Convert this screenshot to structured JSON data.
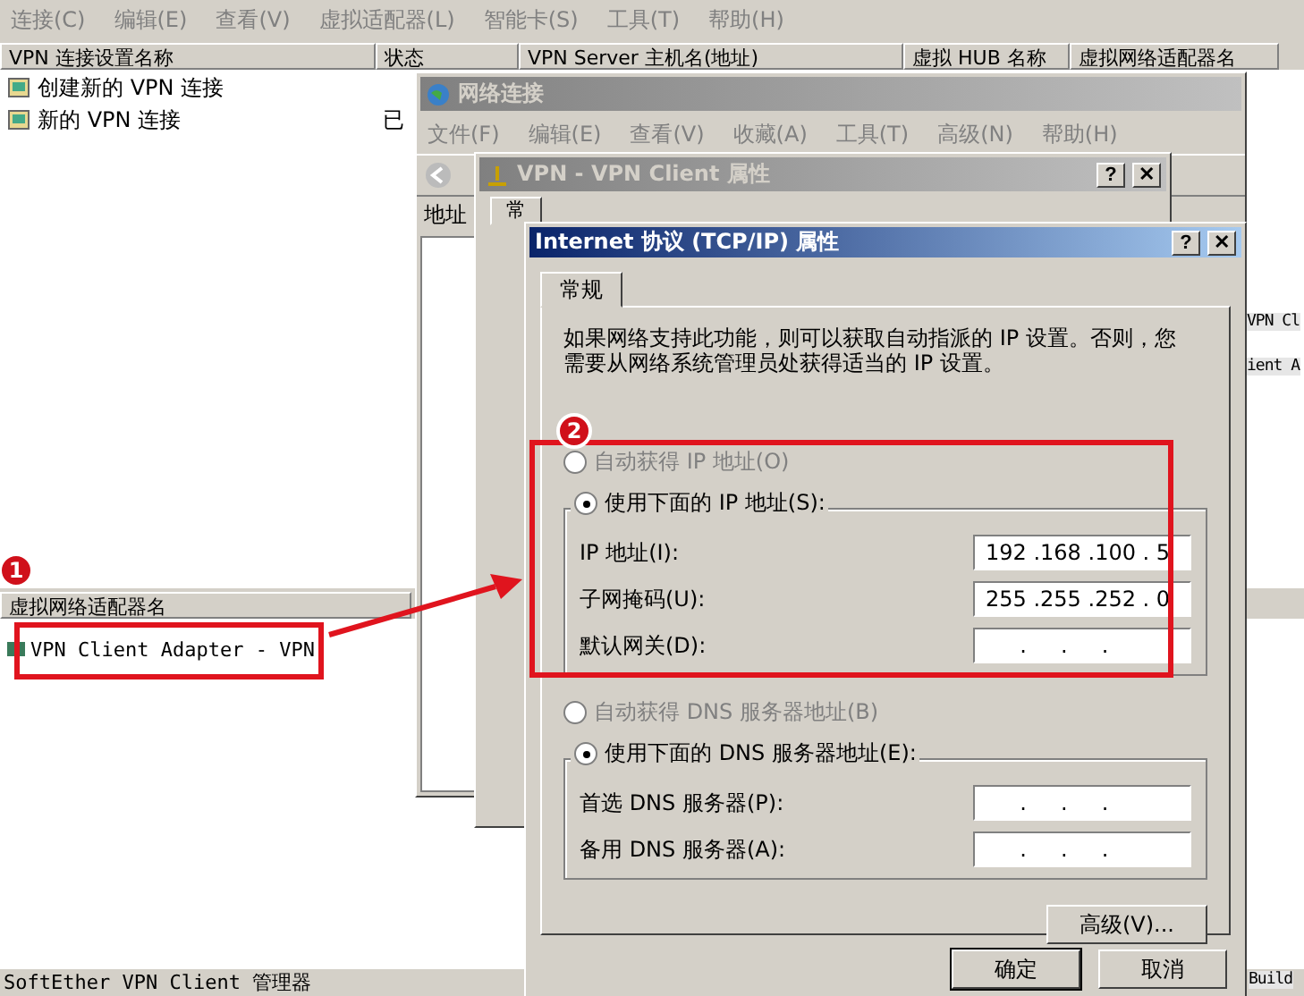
{
  "main_window": {
    "menu": [
      "连接(C)",
      "编辑(E)",
      "查看(V)",
      "虚拟适配器(L)",
      "智能卡(S)",
      "工具(T)",
      "帮助(H)"
    ],
    "columns": [
      "VPN 连接设置名称",
      "状态",
      "VPN Server 主机名(地址)",
      "虚拟 HUB 名称",
      "虚拟网络适配器名"
    ],
    "rows": [
      {
        "name": "创建新的 VPN 连接"
      },
      {
        "name": "新的 VPN 连接",
        "status": "已"
      }
    ],
    "adapter_list": {
      "column": "虚拟网络适配器名",
      "rows": [
        "VPN Client Adapter - VPN"
      ]
    },
    "right_edge_rows": [
      "VPN Cl",
      "ient A"
    ],
    "status_bar": "SoftEther VPN Client 管理器",
    "build": "Build"
  },
  "network_window": {
    "title": "网络连接",
    "menu": [
      "文件(F)",
      "编辑(E)",
      "查看(V)",
      "收藏(A)",
      "工具(T)",
      "高级(N)",
      "帮助(H)"
    ],
    "address_label": "地址"
  },
  "vpn_dialog": {
    "title": "VPN - VPN Client 属性",
    "caption_buttons": [
      "?",
      "✕"
    ],
    "tab": "常"
  },
  "tcpip_dialog": {
    "title": "Internet 协议 (TCP/IP) 属性",
    "caption_buttons": [
      "?",
      "✕"
    ],
    "tabs": [
      {
        "label": "常规",
        "selected": true
      }
    ],
    "description": "如果网络支持此功能，则可以获取自动指派的 IP 设置。否则，您需要从网络系统管理员处获得适当的 IP 设置。",
    "ip_options": [
      {
        "label": "自动获得 IP 地址(O)",
        "selected": false
      },
      {
        "label": "使用下面的 IP 地址(S):",
        "selected": true
      }
    ],
    "ip_fields": [
      {
        "label": "IP 地址(I):",
        "value": "192 .168 .100 . 5"
      },
      {
        "label": "子网掩码(U):",
        "value": "255 .255 .252 . 0"
      },
      {
        "label": "默认网关(D):",
        "value": "     .     .     ."
      }
    ],
    "dns_options": [
      {
        "label": "自动获得 DNS 服务器地址(B)",
        "selected": false
      },
      {
        "label": "使用下面的 DNS 服务器地址(E):",
        "selected": true
      }
    ],
    "dns_fields": [
      {
        "label": "首选 DNS 服务器(P):",
        "value": "     .     .     ."
      },
      {
        "label": "备用 DNS 服务器(A):",
        "value": "     .     .     ."
      }
    ],
    "advanced_button": "高级(V)...",
    "buttons": [
      "确定",
      "取消"
    ]
  },
  "annotations": [
    {
      "number": "1"
    },
    {
      "number": "2"
    }
  ]
}
